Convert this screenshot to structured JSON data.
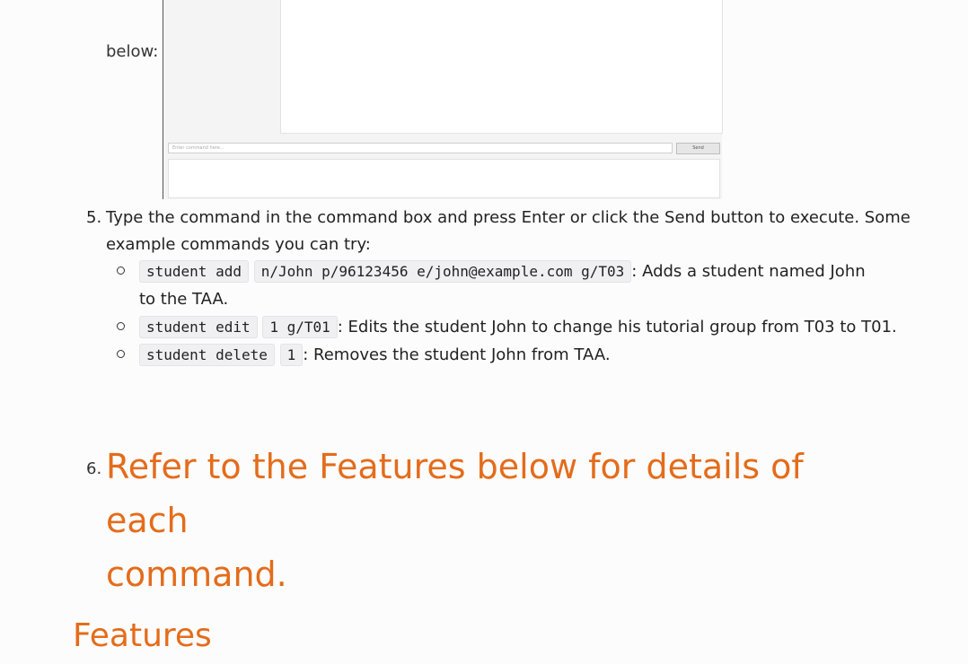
{
  "below_label": "below:",
  "screenshot": {
    "command_placeholder": "Enter command here...",
    "send_label": "Send"
  },
  "step5": {
    "number": "5.",
    "text_line1": "Type the command in the command box and press Enter or click the Send button to execute. Some",
    "text_line2": "example commands you can try:"
  },
  "examples": [
    {
      "code": [
        "student add",
        "n/John p/96123456 e/john@example.com g/T03"
      ],
      "desc1": ": Adds a student named John",
      "desc2": "to the TAA."
    },
    {
      "code": [
        "student edit",
        "1 g/T01"
      ],
      "desc1": ": Edits the student John to change his tutorial group from T03 to T01."
    },
    {
      "code": [
        "student delete",
        "1"
      ],
      "desc1": ": Removes the student John from TAA."
    }
  ],
  "step6": {
    "number": "6.",
    "line1": "Refer to the Features below for details of each",
    "line2": "command."
  },
  "features_heading": "Features",
  "colors": {
    "accent": "#e46c1b"
  }
}
